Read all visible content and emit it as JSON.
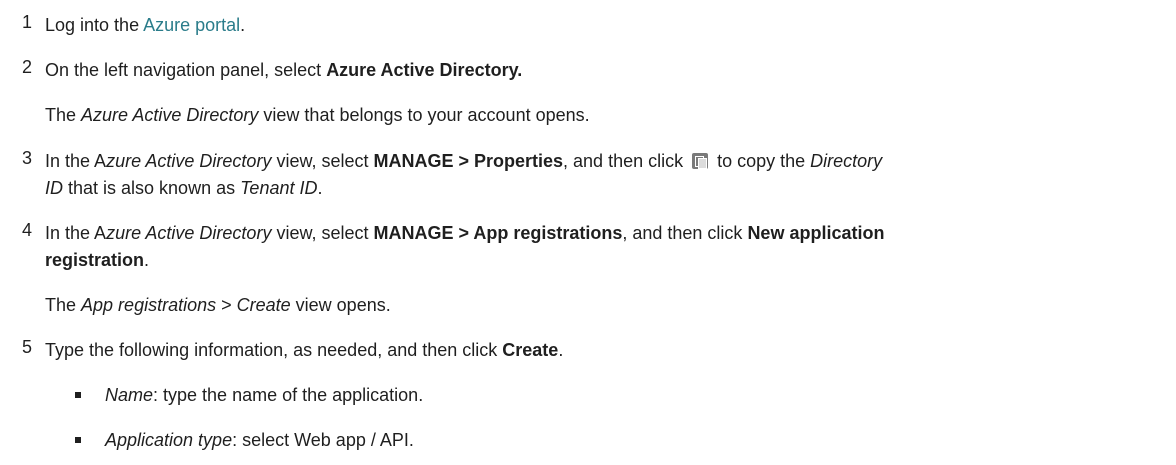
{
  "steps": [
    {
      "num": "1",
      "pre": "Log into the ",
      "link": "Azure portal",
      "post": "."
    },
    {
      "num": "2",
      "pre": "On the left navigation panel, select ",
      "bold": "Azure Active Directory.",
      "note_italic": "Azure Active Directory",
      "note_rest": " view that belongs to your account opens.",
      "note_pre": "The "
    },
    {
      "num": "3",
      "pre": "In the A",
      "italic1": "zure Active Directory",
      "mid1": " view, select ",
      "bold": "MANAGE > Properties",
      "mid2": ", and then click ",
      "mid3": " to copy the ",
      "italic2": "Directory",
      "italic3": "ID",
      "mid4": " that is also known as ",
      "italic4": "Tenant ID",
      "post": "."
    },
    {
      "num": "4",
      "pre": "In the A",
      "italic1": "zure Active Directory",
      "mid1": " view, select ",
      "bold1": "MANAGE > App registrations",
      "mid2": ", and then click ",
      "bold2": "New application",
      "bold3": "registration",
      "post": ".",
      "note_pre": "The ",
      "note_italic1": "App registrations",
      "note_mid": " > ",
      "note_italic2": "Create",
      "note_rest": " view opens."
    },
    {
      "num": "5",
      "pre": "Type the following information, as needed, and then click ",
      "bold": "Create",
      "post": "."
    }
  ],
  "bullets": [
    {
      "label": "Name",
      "text": ": type the name of the application."
    },
    {
      "label": "Application type",
      "text": ": select Web app / API."
    }
  ]
}
